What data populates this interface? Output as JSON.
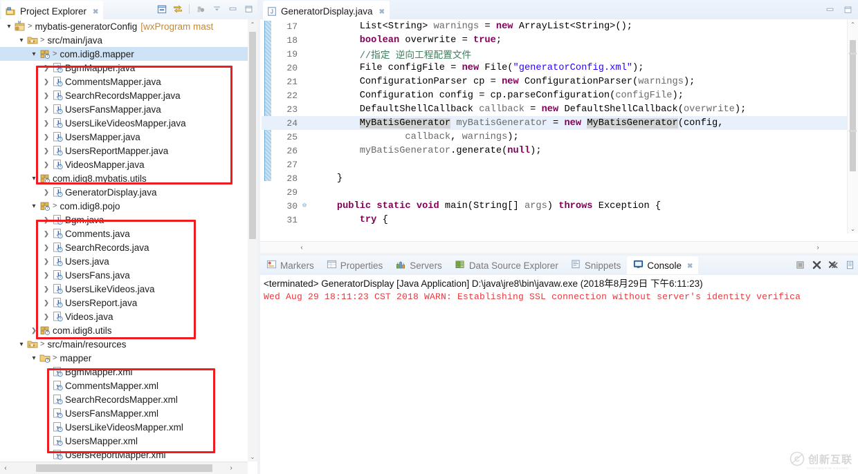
{
  "explorer": {
    "tab_label": "Project Explorer",
    "toolbar": [
      {
        "name": "collapse-all-icon",
        "title": "Collapse All"
      },
      {
        "name": "link-with-editor-icon",
        "title": "Link with Editor"
      },
      {
        "name": "focus-on-active-task-icon",
        "title": "Focus on Active Task"
      },
      {
        "name": "view-menu-icon",
        "title": "View Menu"
      },
      {
        "name": "minimize-icon",
        "title": "Minimize"
      },
      {
        "name": "maximize-icon",
        "title": "Maximize"
      }
    ],
    "tree": [
      {
        "label": "mybatis-generatorConfig",
        "suffix": "[wxProgram mast",
        "indent": 0,
        "twisty": "open",
        "icon": "java-project-icon",
        "gt": true,
        "selected": false
      },
      {
        "label": "src/main/java",
        "suffix": "",
        "indent": 1,
        "twisty": "open",
        "icon": "source-folder-icon",
        "gt": true,
        "selected": false
      },
      {
        "label": "com.idig8.mapper",
        "suffix": "",
        "indent": 2,
        "twisty": "open",
        "icon": "package-icon",
        "gt": true,
        "selected": true
      },
      {
        "label": "BgmMapper.java",
        "suffix": "",
        "indent": 3,
        "twisty": "closed",
        "icon": "java-file-icon",
        "gt": false,
        "selected": false
      },
      {
        "label": "CommentsMapper.java",
        "suffix": "",
        "indent": 3,
        "twisty": "closed",
        "icon": "java-file-icon",
        "gt": false,
        "selected": false
      },
      {
        "label": "SearchRecordsMapper.java",
        "suffix": "",
        "indent": 3,
        "twisty": "closed",
        "icon": "java-file-icon",
        "gt": false,
        "selected": false
      },
      {
        "label": "UsersFansMapper.java",
        "suffix": "",
        "indent": 3,
        "twisty": "closed",
        "icon": "java-file-icon",
        "gt": false,
        "selected": false
      },
      {
        "label": "UsersLikeVideosMapper.java",
        "suffix": "",
        "indent": 3,
        "twisty": "closed",
        "icon": "java-file-icon",
        "gt": false,
        "selected": false
      },
      {
        "label": "UsersMapper.java",
        "suffix": "",
        "indent": 3,
        "twisty": "closed",
        "icon": "java-file-icon",
        "gt": false,
        "selected": false
      },
      {
        "label": "UsersReportMapper.java",
        "suffix": "",
        "indent": 3,
        "twisty": "closed",
        "icon": "java-file-icon",
        "gt": false,
        "selected": false
      },
      {
        "label": "VideosMapper.java",
        "suffix": "",
        "indent": 3,
        "twisty": "closed",
        "icon": "java-file-icon",
        "gt": false,
        "selected": false
      },
      {
        "label": "com.idig8.mybatis.utils",
        "suffix": "",
        "indent": 2,
        "twisty": "open",
        "icon": "package-icon",
        "gt": false,
        "selected": false
      },
      {
        "label": "GeneratorDisplay.java",
        "suffix": "",
        "indent": 3,
        "twisty": "closed",
        "icon": "java-file-icon",
        "gt": false,
        "selected": false
      },
      {
        "label": "com.idig8.pojo",
        "suffix": "",
        "indent": 2,
        "twisty": "open",
        "icon": "package-icon",
        "gt": true,
        "selected": false
      },
      {
        "label": "Bgm.java",
        "suffix": "",
        "indent": 3,
        "twisty": "closed",
        "icon": "java-file-icon",
        "gt": false,
        "selected": false
      },
      {
        "label": "Comments.java",
        "suffix": "",
        "indent": 3,
        "twisty": "closed",
        "icon": "java-file-icon",
        "gt": false,
        "selected": false
      },
      {
        "label": "SearchRecords.java",
        "suffix": "",
        "indent": 3,
        "twisty": "closed",
        "icon": "java-file-icon",
        "gt": false,
        "selected": false
      },
      {
        "label": "Users.java",
        "suffix": "",
        "indent": 3,
        "twisty": "closed",
        "icon": "java-file-icon",
        "gt": false,
        "selected": false
      },
      {
        "label": "UsersFans.java",
        "suffix": "",
        "indent": 3,
        "twisty": "closed",
        "icon": "java-file-icon",
        "gt": false,
        "selected": false
      },
      {
        "label": "UsersLikeVideos.java",
        "suffix": "",
        "indent": 3,
        "twisty": "closed",
        "icon": "java-file-icon",
        "gt": false,
        "selected": false
      },
      {
        "label": "UsersReport.java",
        "suffix": "",
        "indent": 3,
        "twisty": "closed",
        "icon": "java-file-icon",
        "gt": false,
        "selected": false
      },
      {
        "label": "Videos.java",
        "suffix": "",
        "indent": 3,
        "twisty": "closed",
        "icon": "java-file-icon",
        "gt": false,
        "selected": false
      },
      {
        "label": "com.idig8.utils",
        "suffix": "",
        "indent": 2,
        "twisty": "closed",
        "icon": "package-icon",
        "gt": false,
        "selected": false
      },
      {
        "label": "src/main/resources",
        "suffix": "",
        "indent": 1,
        "twisty": "open",
        "icon": "source-folder-icon",
        "gt": true,
        "selected": false
      },
      {
        "label": "mapper",
        "suffix": "",
        "indent": 2,
        "twisty": "open",
        "icon": "folder-icon",
        "gt": true,
        "selected": false
      },
      {
        "label": "BgmMapper.xml",
        "suffix": "",
        "indent": 3,
        "twisty": "none",
        "icon": "xml-file-icon",
        "gt": false,
        "selected": false
      },
      {
        "label": "CommentsMapper.xml",
        "suffix": "",
        "indent": 3,
        "twisty": "none",
        "icon": "xml-file-icon",
        "gt": false,
        "selected": false
      },
      {
        "label": "SearchRecordsMapper.xml",
        "suffix": "",
        "indent": 3,
        "twisty": "none",
        "icon": "xml-file-icon",
        "gt": false,
        "selected": false
      },
      {
        "label": "UsersFansMapper.xml",
        "suffix": "",
        "indent": 3,
        "twisty": "none",
        "icon": "xml-file-icon",
        "gt": false,
        "selected": false
      },
      {
        "label": "UsersLikeVideosMapper.xml",
        "suffix": "",
        "indent": 3,
        "twisty": "none",
        "icon": "xml-file-icon",
        "gt": false,
        "selected": false
      },
      {
        "label": "UsersMapper.xml",
        "suffix": "",
        "indent": 3,
        "twisty": "none",
        "icon": "xml-file-icon",
        "gt": false,
        "selected": false
      },
      {
        "label": "UsersReportMapper.xml",
        "suffix": "",
        "indent": 3,
        "twisty": "none",
        "icon": "xml-file-icon",
        "gt": false,
        "selected": false
      }
    ],
    "scroll_arrow_up": "⌃",
    "scroll_arrow_down": "⌄",
    "scroll_arrow_left": "‹",
    "scroll_arrow_right": "›"
  },
  "editor": {
    "tab_label": "GeneratorDisplay.java",
    "tab_icon": "java-file-icon",
    "minimize_title": "Minimize",
    "maximize_title": "Maximize",
    "first_line": 17,
    "highlight_line": 24,
    "fold_line": 30,
    "lines": [
      {
        "n": "17",
        "segments": [
          {
            "t": "        List<String> ",
            "c": "plain"
          },
          {
            "t": "warnings",
            "c": "var"
          },
          {
            "t": " = ",
            "c": "plain"
          },
          {
            "t": "new",
            "c": "kw"
          },
          {
            "t": " ArrayList<String>();",
            "c": "plain"
          }
        ]
      },
      {
        "n": "18",
        "segments": [
          {
            "t": "        ",
            "c": "plain"
          },
          {
            "t": "boolean",
            "c": "kw"
          },
          {
            "t": " overwrite = ",
            "c": "plain"
          },
          {
            "t": "true",
            "c": "kw"
          },
          {
            "t": ";",
            "c": "plain"
          }
        ]
      },
      {
        "n": "19",
        "segments": [
          {
            "t": "        //指定 逆向工程配置文件",
            "c": "cmt"
          }
        ]
      },
      {
        "n": "20",
        "segments": [
          {
            "t": "        File configFile = ",
            "c": "plain"
          },
          {
            "t": "new",
            "c": "kw"
          },
          {
            "t": " File(",
            "c": "plain"
          },
          {
            "t": "\"generatorConfig.xml\"",
            "c": "str"
          },
          {
            "t": ");",
            "c": "plain"
          }
        ]
      },
      {
        "n": "21",
        "segments": [
          {
            "t": "        ConfigurationParser cp = ",
            "c": "plain"
          },
          {
            "t": "new",
            "c": "kw"
          },
          {
            "t": " ConfigurationParser(",
            "c": "plain"
          },
          {
            "t": "warnings",
            "c": "var"
          },
          {
            "t": ");",
            "c": "plain"
          }
        ]
      },
      {
        "n": "22",
        "segments": [
          {
            "t": "        Configuration config = cp.parseConfiguration(",
            "c": "plain"
          },
          {
            "t": "configFile",
            "c": "var"
          },
          {
            "t": ");",
            "c": "plain"
          }
        ]
      },
      {
        "n": "23",
        "segments": [
          {
            "t": "        DefaultShellCallback ",
            "c": "plain"
          },
          {
            "t": "callback",
            "c": "var"
          },
          {
            "t": " = ",
            "c": "plain"
          },
          {
            "t": "new",
            "c": "kw"
          },
          {
            "t": " DefaultShellCallback(",
            "c": "plain"
          },
          {
            "t": "overwrite",
            "c": "var"
          },
          {
            "t": ");",
            "c": "plain"
          }
        ]
      },
      {
        "n": "24",
        "segments": [
          {
            "t": "        ",
            "c": "plain"
          },
          {
            "t": "MyBatisGenerator",
            "c": "occ"
          },
          {
            "t": " ",
            "c": "plain"
          },
          {
            "t": "myBatisGenerator",
            "c": "var"
          },
          {
            "t": " = ",
            "c": "plain"
          },
          {
            "t": "new",
            "c": "kw"
          },
          {
            "t": " ",
            "c": "plain"
          },
          {
            "t": "MyBatisGenerator",
            "c": "occ"
          },
          {
            "t": "(config,",
            "c": "plain"
          }
        ]
      },
      {
        "n": "25",
        "segments": [
          {
            "t": "                ",
            "c": "plain"
          },
          {
            "t": "callback",
            "c": "var"
          },
          {
            "t": ", ",
            "c": "plain"
          },
          {
            "t": "warnings",
            "c": "var"
          },
          {
            "t": ");",
            "c": "plain"
          }
        ]
      },
      {
        "n": "26",
        "segments": [
          {
            "t": "        ",
            "c": "plain"
          },
          {
            "t": "myBatisGenerator",
            "c": "var"
          },
          {
            "t": ".generate(",
            "c": "plain"
          },
          {
            "t": "null",
            "c": "kw"
          },
          {
            "t": ");",
            "c": "plain"
          }
        ]
      },
      {
        "n": "27",
        "segments": [
          {
            "t": "",
            "c": "plain"
          }
        ]
      },
      {
        "n": "28",
        "segments": [
          {
            "t": "    }",
            "c": "plain"
          }
        ]
      },
      {
        "n": "29",
        "segments": [
          {
            "t": "",
            "c": "plain"
          }
        ]
      },
      {
        "n": "30",
        "segments": [
          {
            "t": "    ",
            "c": "plain"
          },
          {
            "t": "public static void",
            "c": "kw"
          },
          {
            "t": " main(String[] ",
            "c": "plain"
          },
          {
            "t": "args",
            "c": "var"
          },
          {
            "t": ") ",
            "c": "plain"
          },
          {
            "t": "throws",
            "c": "kw"
          },
          {
            "t": " Exception {",
            "c": "plain"
          }
        ]
      },
      {
        "n": "31",
        "segments": [
          {
            "t": "        ",
            "c": "plain"
          },
          {
            "t": "try",
            "c": "kw"
          },
          {
            "t": " {",
            "c": "plain"
          }
        ]
      }
    ]
  },
  "console": {
    "tabs": [
      {
        "label": "Markers",
        "icon": "markers-icon",
        "active": false
      },
      {
        "label": "Properties",
        "icon": "properties-icon",
        "active": false
      },
      {
        "label": "Servers",
        "icon": "servers-icon",
        "active": false
      },
      {
        "label": "Data Source Explorer",
        "icon": "data-source-explorer-icon",
        "active": false
      },
      {
        "label": "Snippets",
        "icon": "snippets-icon",
        "active": false
      },
      {
        "label": "Console",
        "icon": "console-icon",
        "active": true
      }
    ],
    "toolbar": [
      {
        "name": "terminate-icon",
        "title": "Terminate"
      },
      {
        "name": "remove-launch-icon",
        "title": "Remove Launch"
      },
      {
        "name": "remove-all-terminated-icon",
        "title": "Remove All Terminated Launches"
      },
      {
        "name": "clear-console-icon",
        "title": "Clear Console"
      }
    ],
    "status_line": "<terminated> GeneratorDisplay [Java Application] D:\\java\\jre8\\bin\\javaw.exe (2018年8月29日 下午6:11:23)",
    "warn_line": "Wed Aug 29 18:11:23 CST 2018 WARN: Establishing SSL connection without server's identity verifica"
  },
  "watermark": {
    "text": "创新互联",
    "sub": "CHUANGXIN HULIAN"
  },
  "colors": {
    "accent_blue": "#cfe3f7",
    "annotation_red": "#ee1c21",
    "console_warn": "#e8383d",
    "keyword": "#7f0055",
    "string": "#2a00ff",
    "comment": "#3f7f5f"
  }
}
